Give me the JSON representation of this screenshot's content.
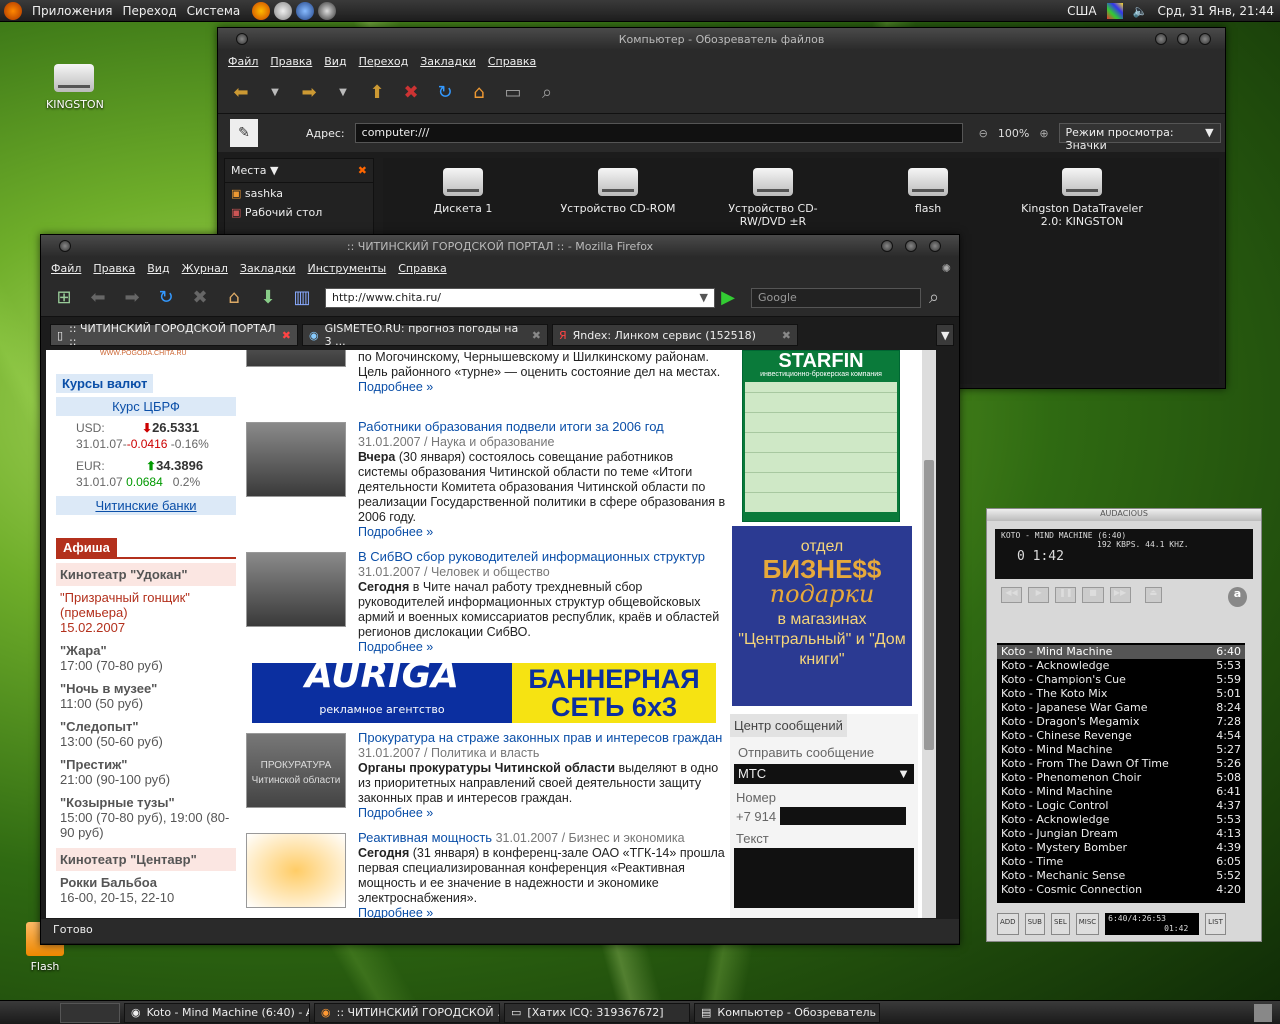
{
  "top_panel": {
    "menus": [
      "Приложения",
      "Переход",
      "Система"
    ],
    "lang": "США",
    "clock": "Срд, 31 Янв, 21:44"
  },
  "desktop": {
    "kingston_label": "KINGSTON",
    "flash_label": "Flash"
  },
  "nautilus": {
    "title": "Компьютер - Обозреватель файлов",
    "menus": [
      "Файл",
      "Правка",
      "Вид",
      "Переход",
      "Закладки",
      "Справка"
    ],
    "address_label": "Адрес:",
    "address": "computer:///",
    "zoom": "100%",
    "view_mode": "Режим просмотра: Значки",
    "places_header": "Места ▼",
    "places": [
      "sashka",
      "Рабочий стол"
    ],
    "items": [
      "Дискета 1",
      "Устройство CD-ROM",
      "Устройство CD-RW/DVD ±R",
      "flash",
      "Kingston DataTraveler 2.0: KINGSTON"
    ]
  },
  "firefox": {
    "title": ":: ЧИТИНСКИЙ ГОРОДСКОЙ ПОРТАЛ :: - Mozilla Firefox",
    "menus": [
      "Файл",
      "Правка",
      "Вид",
      "Журнал",
      "Закладки",
      "Инструменты",
      "Справка"
    ],
    "url": "http://www.chita.ru/",
    "search_placeholder": "Google",
    "tabs": [
      ":: ЧИТИНСКИЙ ГОРОДСКОЙ ПОРТАЛ ::",
      "GISMETEO.RU: прогноз погоды на 3 ...",
      "Яndex: Линком сервис (152518)"
    ],
    "status": "Готово"
  },
  "page": {
    "top_small": "WWW.POGODA.CHITA.RU",
    "currency": {
      "header": "Курсы валют",
      "cbr": "Курс ЦБРФ",
      "usd_label": "USD:",
      "usd_value": "26.5331",
      "usd_date": "31.01.07",
      "usd_change": "-0.0416",
      "usd_pct": "-0.16%",
      "eur_label": "EUR:",
      "eur_value": "34.3896",
      "eur_date": "31.01.07",
      "eur_change": "0.0684",
      "eur_pct": "0.2%",
      "banks": "Читинские банки"
    },
    "afisha": {
      "header": "Афиша",
      "cinema1": "Кинотеатр \"Удокан\"",
      "films": [
        {
          "name": "\"Призрачный гонщик\"(премьера)",
          "time": "15.02.2007",
          "hot": true
        },
        {
          "name": "\"Жара\"",
          "time": "17:00 (70-80 руб)"
        },
        {
          "name": "\"Ночь в музее\"",
          "time": "11:00 (50 руб)"
        },
        {
          "name": "\"Следопыт\"",
          "time": "13:00 (50-60 руб)"
        },
        {
          "name": "\"Престиж\"",
          "time": "21:00 (90-100 руб)"
        },
        {
          "name": "\"Козырные тузы\"",
          "time": "15:00 (70-80 руб), 19:00 (80-90 руб)"
        }
      ],
      "cinema2": "Кинотеатр \"Центавр\"",
      "film2_name": "Рокки Бальбоа",
      "film2_time": "16-00, 20-15, 22-10"
    },
    "news": [
      {
        "top_text": "по Могочинскому, Чернышевскому и Шилкинскому районам. Цель районного «турне» — оценить состояние дел на местах.",
        "more": "Подробнее »"
      },
      {
        "title": "Работники образования подвели итоги за 2006 год",
        "date": "31.01.2007 / Наука и образование",
        "bold": "Вчера",
        "text": " (30 января) состоялось совещание работников системы образования Читинской области по теме «Итоги деятельности Комитета образования Читинской области по реализации Государственной политики в сфере образования в 2006 году.",
        "more": "Подробнее »"
      },
      {
        "title": "В СибВО сбор руководителей информационных структур",
        "date": "31.01.2007 / Человек и общество",
        "bold": "Сегодня",
        "text": " в Чите начал работу трехдневный сбор руководителей информационных структур общевойсковых армий и военных комиссариатов республик, краёв и областей регионов дислокации СибВО.",
        "more": "Подробнее »"
      },
      {
        "title": "Прокуратура на страже законных прав и интересов граждан",
        "date": "31.01.2007 / Политика и власть",
        "bold": "Органы прокуратуры Читинской области",
        "text": " выделяют в одно из приоритетных направлений своей деятельности защиту законных прав и интересов граждан.",
        "more": "Подробнее »"
      },
      {
        "title": "Реактивная мощность",
        "date": "31.01.2007 / Бизнес и экономика",
        "bold": "Сегодня",
        "text": " (31 января) в конференц-зале ОАО «ТГК-14» прошла первая специализированная конференция «Реактивная мощность и ее значение в надежности и экономике электроснабжения».",
        "more": "Подробнее »"
      }
    ],
    "banner": {
      "brand": "AURIGA",
      "brand_sub": "рекламное агентство",
      "big": "БАННЕРНАЯ СЕТЬ 6x3"
    },
    "starfin": {
      "name": "STARFIN",
      "sub": "инвестиционно-брокерская компания"
    },
    "gifts": {
      "l1": "отдел",
      "l2": "БИЗНЕ$$",
      "l3": "подарки",
      "l4": "в магазинах \"Центральный\" и \"Дом книги\""
    },
    "messages": {
      "header": "Центр сообщений",
      "send": "Отправить сообщение",
      "operator": "МТС",
      "number_label": "Номер",
      "prefix": "+7 914",
      "text_label": "Текст"
    },
    "prosecutor_sign": "ПРОКУРАТУРА Читинской области"
  },
  "audacious": {
    "title": "AUDACIOUS",
    "song": "KOTO - MIND MACHINE (6:40)",
    "info": "192 KBPS. 44.1 KHZ.",
    "time": "0 1:42",
    "tracks": [
      {
        "n": "Koto - Mind Machine",
        "t": "6:40"
      },
      {
        "n": "Koto - Acknowledge",
        "t": "5:53"
      },
      {
        "n": "Koto - Champion's Cue",
        "t": "5:59"
      },
      {
        "n": "Koto - The Koto Mix",
        "t": "5:01"
      },
      {
        "n": "Koto - Japanese War Game",
        "t": "8:24"
      },
      {
        "n": "Koto - Dragon's Megamix",
        "t": "7:28"
      },
      {
        "n": "Koto - Chinese Revenge",
        "t": "4:54"
      },
      {
        "n": "Koto - Mind Machine",
        "t": "5:27"
      },
      {
        "n": "Koto - From The Dawn Of Time",
        "t": "5:26"
      },
      {
        "n": "Koto - Phenomenon Choir",
        "t": "5:08"
      },
      {
        "n": "Koto - Mind Machine",
        "t": "6:41"
      },
      {
        "n": "Koto - Logic Control",
        "t": "4:37"
      },
      {
        "n": "Koto - Acknowledge",
        "t": "5:53"
      },
      {
        "n": "Koto - Jungian Dream",
        "t": "4:13"
      },
      {
        "n": "Koto - Mystery Bomber",
        "t": "4:39"
      },
      {
        "n": "Koto - Time",
        "t": "6:05"
      },
      {
        "n": "Koto - Mechanic Sense",
        "t": "5:52"
      },
      {
        "n": "Koto - Cosmic Connection",
        "t": "4:20"
      }
    ],
    "buttons": [
      "ADD",
      "SUB",
      "SEL",
      "MISC",
      "LIST"
    ],
    "pl_time": "6:40/4:26:53",
    "pl_time2": "01:42"
  },
  "taskbar": [
    "Koto - Mind Machine (6:40) - A...",
    ":: ЧИТИНСКИЙ ГОРОДСКОЙ ...",
    "[Хатих ICQ: 319367672]",
    "Компьютер - Обозреватель ..."
  ]
}
